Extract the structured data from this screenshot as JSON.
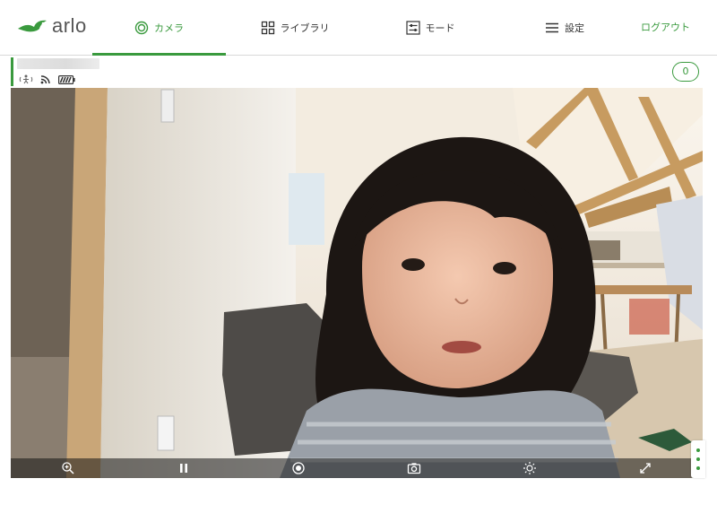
{
  "brand": {
    "name": "arlo",
    "accent": "#3a9a3e"
  },
  "nav": {
    "tabs": [
      {
        "label": "カメラ",
        "icon": "camera-target-icon",
        "active": true
      },
      {
        "label": "ライブラリ",
        "icon": "grid-icon",
        "active": false
      },
      {
        "label": "モード",
        "icon": "mode-sliders-icon",
        "active": false
      },
      {
        "label": "設定",
        "icon": "menu-icon",
        "active": false
      }
    ],
    "logout_label": "ログアウト"
  },
  "camera": {
    "notification_count": "0",
    "status_icons": [
      "motion-icon",
      "wifi-signal-icon",
      "battery-icon"
    ]
  },
  "video_controls": [
    "zoom-in-icon",
    "pause-icon",
    "record-icon",
    "snapshot-camera-icon",
    "brightness-icon",
    "fullscreen-icon"
  ]
}
